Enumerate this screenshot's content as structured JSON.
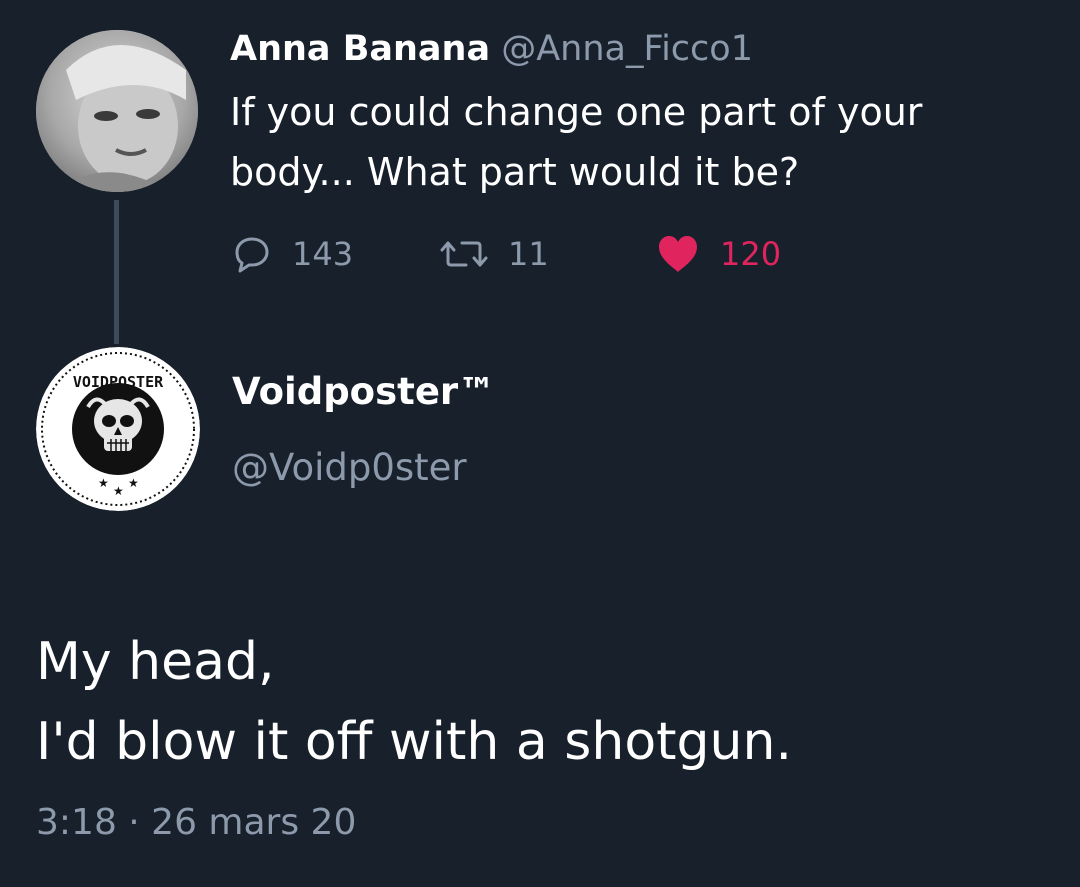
{
  "quoted_tweet": {
    "author_name": "Anna Banana",
    "author_handle": "@Anna_Ficco1",
    "text": "If you could change one part of your body... What part would it be?",
    "actions": {
      "replies": "143",
      "retweets": "11",
      "likes": "120"
    },
    "icons": {
      "reply": "reply-bubble-icon",
      "retweet": "retweet-icon",
      "like": "heart-icon"
    }
  },
  "tweet": {
    "author_name": "Voidposter™",
    "author_handle": "@Voidp0ster",
    "avatar_logo_text": "VOIDPOSTER",
    "text_lines": [
      "My head,",
      "I'd blow it off with a shotgun."
    ],
    "timestamp": "3:18 · 26 mars 20"
  },
  "colors": {
    "background": "#17202b",
    "text_primary": "#ffffff",
    "text_secondary": "#8c9aab",
    "like_accent": "#e0245e",
    "thread_line": "#3d4b5c"
  }
}
